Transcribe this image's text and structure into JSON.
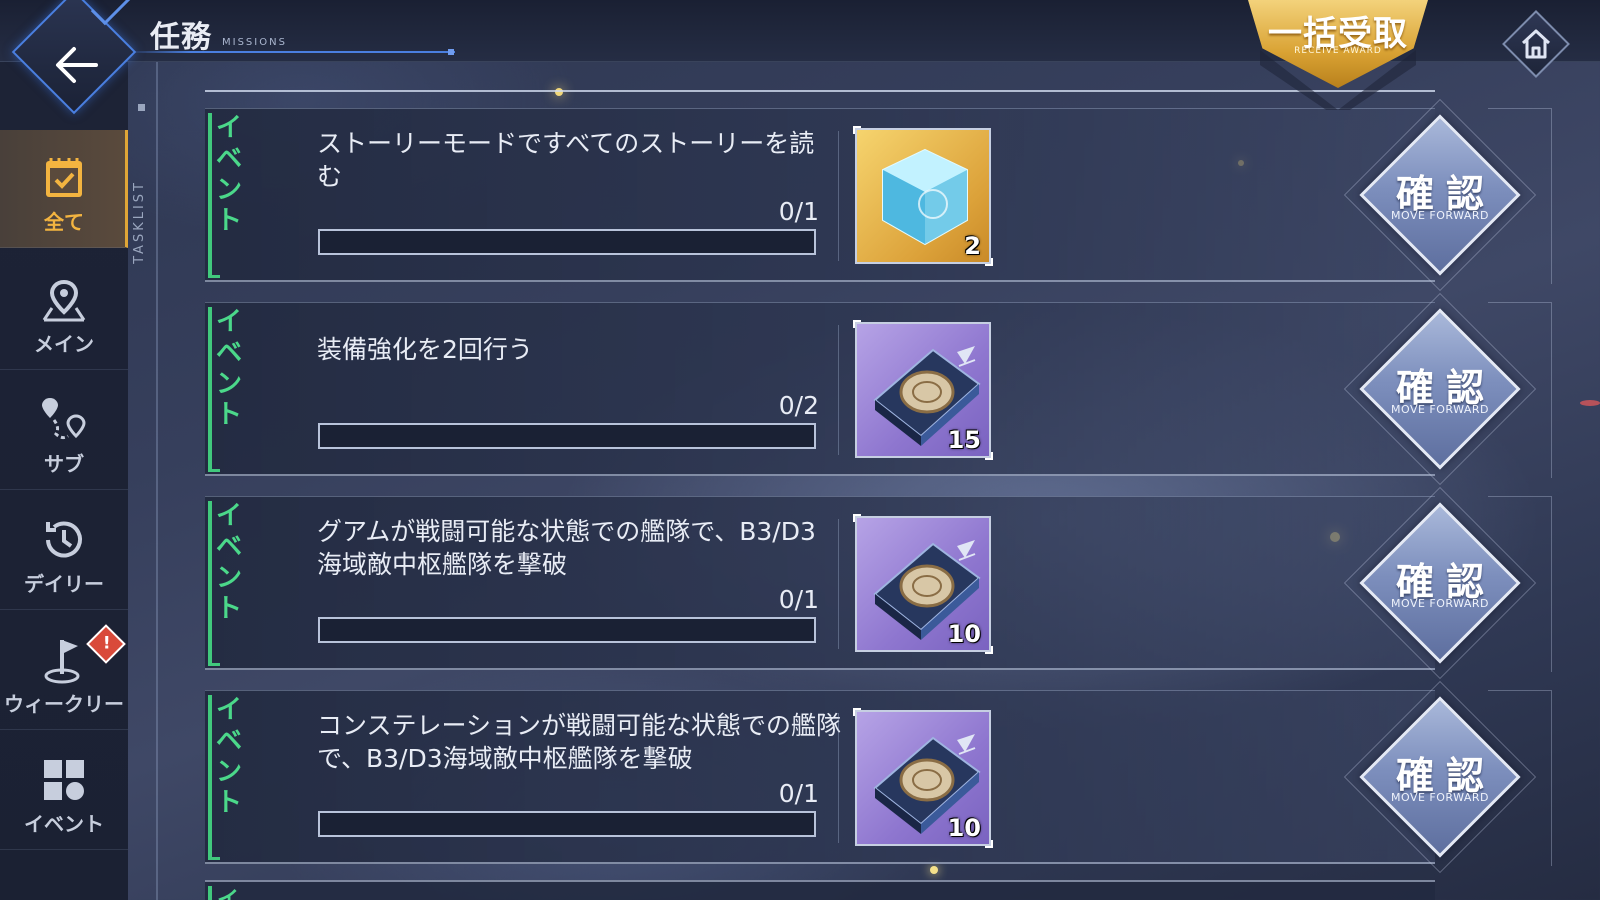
{
  "header": {
    "title": "任務",
    "subtitle": "MISSIONS",
    "receive_all": {
      "label": "一括受取",
      "sub": "RECEIVE AWARD"
    }
  },
  "sidebar": {
    "section_label": "TASKLIST",
    "items": [
      {
        "label": "全て",
        "icon": "calendar-check-icon",
        "active": true
      },
      {
        "label": "メイン",
        "icon": "map-pin-icon",
        "active": false
      },
      {
        "label": "サブ",
        "icon": "route-pins-icon",
        "active": false
      },
      {
        "label": "デイリー",
        "icon": "clock-history-icon",
        "active": false
      },
      {
        "label": "ウィークリー",
        "icon": "flag-icon",
        "active": false,
        "alert": "!"
      },
      {
        "label": "イベント",
        "icon": "event-grid-icon",
        "active": false
      }
    ]
  },
  "missions": [
    {
      "category": "イベント",
      "description": "ストーリーモードですべてのストーリーを読む",
      "progress": "0/1",
      "progress_fraction": 0,
      "reward": {
        "icon": "cube-crystal-icon",
        "quantity": "2",
        "rarity": "gold"
      },
      "confirm_label": "確認",
      "confirm_sub": "MOVE FORWARD"
    },
    {
      "category": "イベント",
      "description": "装備強化を2回行う",
      "progress": "0/2",
      "progress_fraction": 0,
      "reward": {
        "icon": "equipment-blueprint-icon",
        "quantity": "15",
        "rarity": "purple"
      },
      "confirm_label": "確認",
      "confirm_sub": "MOVE FORWARD"
    },
    {
      "category": "イベント",
      "description": "グアムが戦闘可能な状態での艦隊で、B3/D3海域敵中枢艦隊を撃破",
      "progress": "0/1",
      "progress_fraction": 0,
      "reward": {
        "icon": "equipment-blueprint-icon",
        "quantity": "10",
        "rarity": "purple"
      },
      "confirm_label": "確認",
      "confirm_sub": "MOVE FORWARD"
    },
    {
      "category": "イベント",
      "description": "コンステレーションが戦闘可能な状態での艦隊で、B3/D3海域敵中枢艦隊を撃破",
      "progress": "0/1",
      "progress_fraction": 0,
      "reward": {
        "icon": "equipment-blueprint-icon",
        "quantity": "10",
        "rarity": "purple"
      },
      "confirm_label": "確認",
      "confirm_sub": "MOVE FORWARD"
    }
  ],
  "partial_next_item_category": "イ",
  "colors": {
    "accent_blue": "#4a7fe0",
    "gold": "#dca23a",
    "event_green": "#41c97d",
    "active_tab": "#f3b440"
  }
}
